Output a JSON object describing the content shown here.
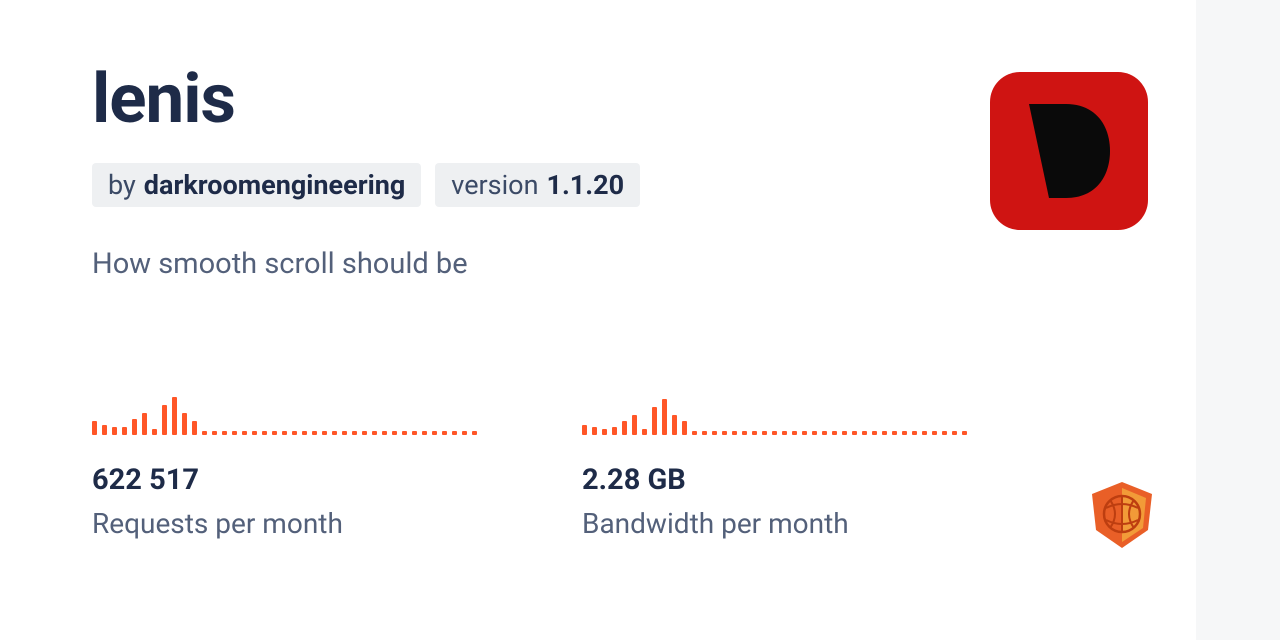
{
  "package": {
    "name": "lenis",
    "author_prefix": "by",
    "author": "darkroomengineering",
    "version_prefix": "version",
    "version": "1.1.20",
    "description": "How smooth scroll should be"
  },
  "stats": {
    "requests": {
      "value": "622 517",
      "label": "Requests per month"
    },
    "bandwidth": {
      "value": "2.28 GB",
      "label": "Bandwidth per month"
    }
  },
  "spark_requests": [
    14,
    10,
    8,
    8,
    16,
    22,
    6,
    30,
    38,
    22,
    14,
    4,
    4,
    4,
    4,
    4,
    4,
    4,
    4,
    4,
    4,
    4,
    4,
    4,
    4,
    4,
    4,
    4,
    4,
    4,
    4,
    4,
    4,
    4,
    4,
    4,
    4,
    4,
    4
  ],
  "spark_bandwidth": [
    10,
    8,
    6,
    8,
    14,
    20,
    6,
    28,
    36,
    20,
    14,
    4,
    4,
    4,
    4,
    4,
    4,
    4,
    4,
    4,
    4,
    4,
    4,
    4,
    4,
    4,
    4,
    4,
    4,
    4,
    4,
    4,
    4,
    4,
    4,
    4,
    4,
    4,
    4
  ],
  "logo": {
    "bg": "#cf1412",
    "letter": "D"
  }
}
